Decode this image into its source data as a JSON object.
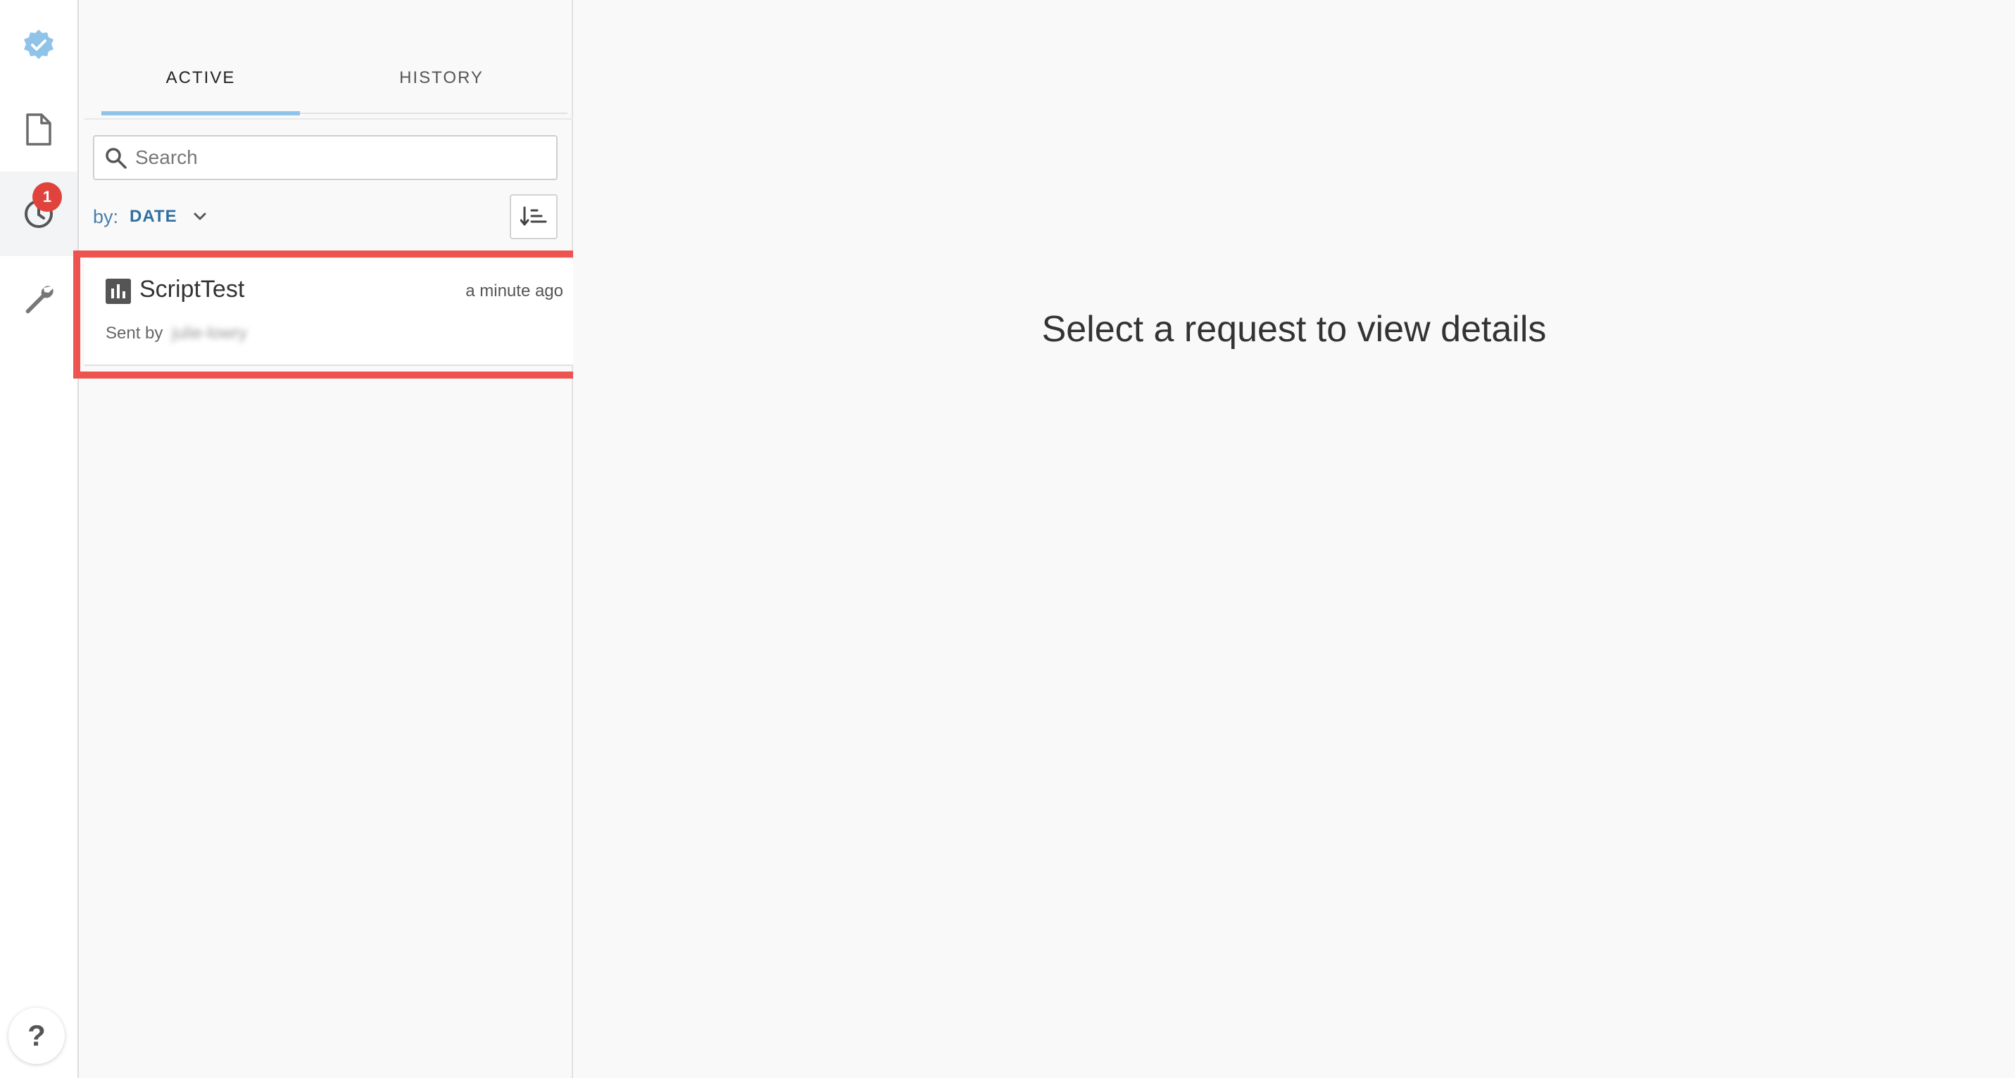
{
  "rail": {
    "badge_count": "1",
    "help_label": "?"
  },
  "panel": {
    "tabs": [
      {
        "label": "ACTIVE"
      },
      {
        "label": "HISTORY"
      }
    ],
    "search": {
      "placeholder": "Search",
      "value": ""
    },
    "sort": {
      "label": "by:",
      "value": "DATE"
    },
    "requests": [
      {
        "title": "ScriptTest",
        "time": "a minute ago",
        "sent_by_label": "Sent by",
        "sent_by_name": "julie-lowry"
      }
    ]
  },
  "main": {
    "empty_text": "Select a request to view details"
  },
  "colors": {
    "accent": "#8fc3e7",
    "badge": "#e0433c",
    "highlight": "#ef5350",
    "link": "#2f6f9f"
  }
}
